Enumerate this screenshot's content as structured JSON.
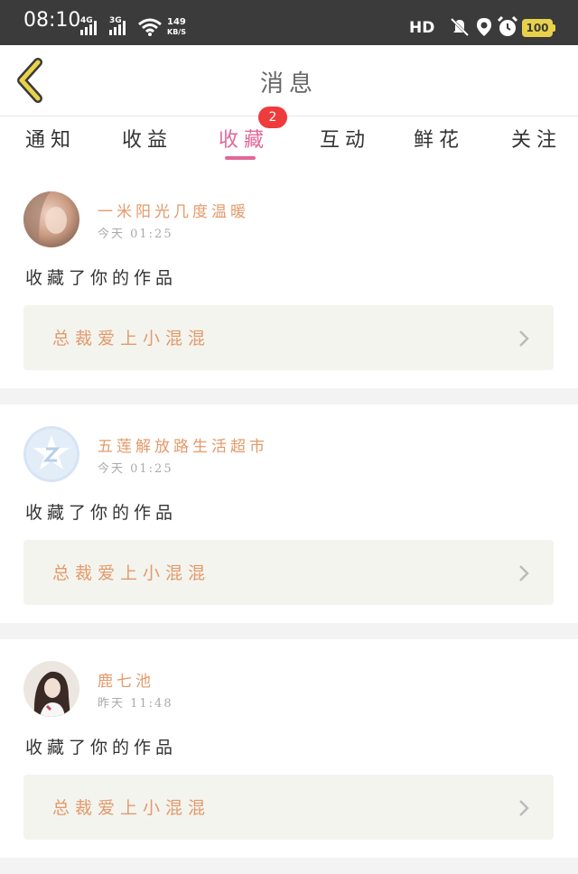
{
  "status_bar": {
    "time": "08:10",
    "signal1": "4G",
    "signal2": "3G",
    "speed_value": "149",
    "speed_unit": "KB/S",
    "hd": "HD",
    "battery": "100"
  },
  "header": {
    "title": "消息"
  },
  "tabs": [
    {
      "label": "通知"
    },
    {
      "label": "收益"
    },
    {
      "label": "收藏",
      "badge": "2"
    },
    {
      "label": "互动"
    },
    {
      "label": "鲜花"
    },
    {
      "label": "关注"
    }
  ],
  "items": [
    {
      "name": "一米阳光几度温暖",
      "time": "今天 01:25",
      "action": "收藏了你的作品",
      "work": "总裁爱上小混混"
    },
    {
      "name": "五莲解放路生活超市",
      "time": "今天 01:25",
      "action": "收藏了你的作品",
      "work": "总裁爱上小混混"
    },
    {
      "name": "鹿七池",
      "time": "昨天 11:48",
      "action": "收藏了你的作品",
      "work": "总裁爱上小混混"
    }
  ],
  "colors": {
    "accent": "#e2679a",
    "name_color": "#e39a6a",
    "badge": "#ee3b3b",
    "back_arrow": "#e8d24a"
  },
  "icons": {
    "back": "back-chevron-icon",
    "chevron": "chevron-right-icon",
    "wifi": "wifi-icon",
    "mute": "mute-icon",
    "location": "location-icon",
    "alarm": "alarm-icon"
  }
}
